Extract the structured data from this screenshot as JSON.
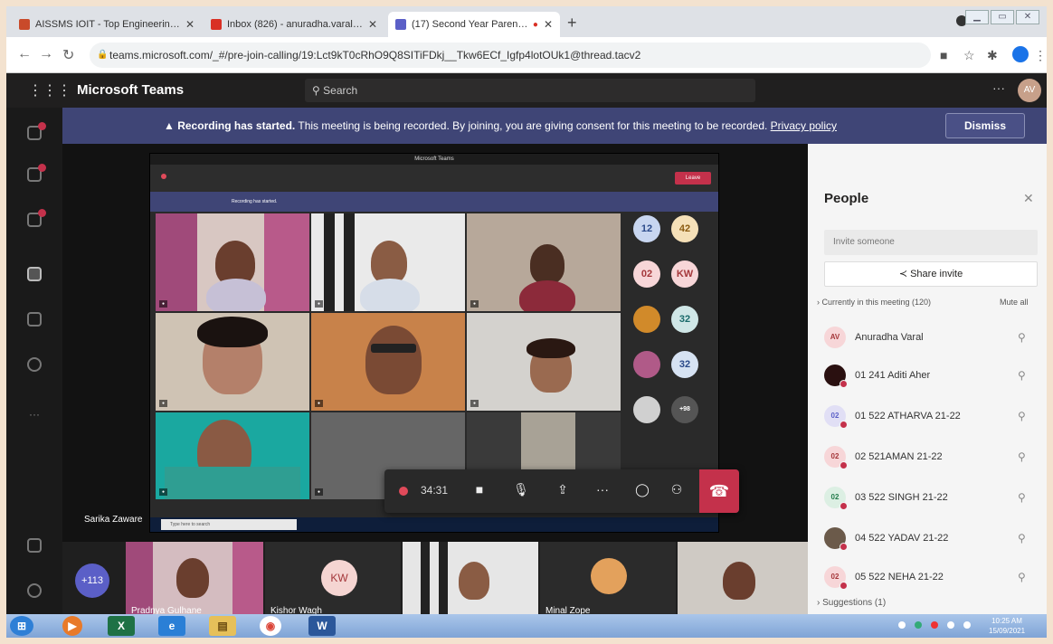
{
  "browser": {
    "tabs": [
      {
        "title": "AISSMS IOIT - Top Engineering C",
        "favicon_color": "#c94a2a"
      },
      {
        "title": "Inbox (826) - anuradha.varal@ai",
        "favicon_color": "#d93025"
      },
      {
        "title": "(17) Second Year Parents Me",
        "favicon_color": "#5b5fc7",
        "recording": true
      }
    ],
    "new_tab": "+",
    "url": "teams.microsoft.com/_#/pre-join-calling/19:Lct9kT0cRhO9Q8SITiFDkj__Tkw6ECf_Igfp4lotOUk1@thread.tacv2"
  },
  "teams": {
    "app_name": "Microsoft Teams",
    "search_placeholder": "Search",
    "user_initials": "AV"
  },
  "banner": {
    "bold": "Recording has started.",
    "text": " This meeting is being recorded. By joining, you are giving consent for this meeting to be recorded. ",
    "link": "Privacy policy",
    "dismiss": "Dismiss"
  },
  "shared_screen": {
    "window_title": "Microsoft Teams",
    "leave": "Leave",
    "banner": "Recording has started.",
    "taskbar_search": "Type here to search",
    "mini_tiles": [
      "12",
      "42",
      "02",
      "KW",
      "32",
      "32",
      "+98"
    ],
    "presenter": "Sarika Zaware"
  },
  "controls": {
    "timer": "34:31"
  },
  "gallery": {
    "overflow": "+113",
    "tiles": [
      {
        "name": "Pradnya Gulhane"
      },
      {
        "name": "Kishor Wagh",
        "initials": "KW"
      },
      {
        "name": ""
      },
      {
        "name": "Minal Zope"
      },
      {
        "name": ""
      }
    ]
  },
  "people": {
    "title": "People",
    "invite_placeholder": "Invite someone",
    "share_invite": "Share invite",
    "in_meeting": "Currently in this meeting (120)",
    "mute_all": "Mute all",
    "participants": [
      {
        "initials": "AV",
        "name": "Anuradha Varal",
        "bg": "#f7d6d8",
        "fg": "#a4373a"
      },
      {
        "initials": "",
        "name": "01 241 Aditi Aher",
        "bg": "#3a1f1f",
        "fg": "#fff"
      },
      {
        "initials": "02",
        "name": "01 522 ATHARVA 21-22",
        "bg": "#e1dff5",
        "fg": "#5b5fc7"
      },
      {
        "initials": "02",
        "name": "02 521AMAN 21-22",
        "bg": "#f7d6d8",
        "fg": "#a4373a"
      },
      {
        "initials": "02",
        "name": "03 522 SINGH 21-22",
        "bg": "#dcefe3",
        "fg": "#237b4b"
      },
      {
        "initials": "",
        "name": "04 522 YADAV 21-22",
        "bg": "#6b5a4a",
        "fg": "#fff"
      },
      {
        "initials": "02",
        "name": "05 522 NEHA 21-22",
        "bg": "#f7d6d8",
        "fg": "#a4373a"
      }
    ],
    "suggestions": "Suggestions (1)"
  },
  "taskbar": {
    "time": "10:25 AM",
    "date": "15/09/2021"
  }
}
